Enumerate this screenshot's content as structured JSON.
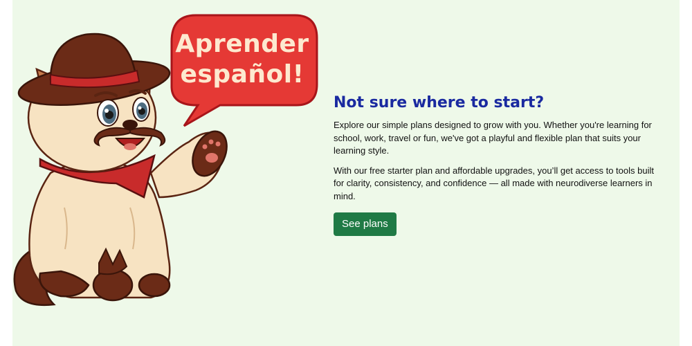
{
  "hero": {
    "speech_bubble_text": "Aprender español!",
    "heading": "Not sure where to start?",
    "paragraph_1": "Explore our simple plans designed to grow with you. Whether you're learning for school, work, travel or fun, we've got a playful and flexible plan that suits your learning style.",
    "paragraph_2": "With our free starter plan and affordable upgrades, you’ll get access to tools built for clarity, consistency, and confidence — all made with neurodiverse learners in mind.",
    "cta_label": "See plans"
  },
  "colors": {
    "panel_background": "#eef9e9",
    "heading": "#1a2aa0",
    "button": "#1f7a45",
    "bubble": "#e53935",
    "bubble_text": "#fde9cf"
  },
  "icons": {
    "mascot": "cat-mascot-illustration",
    "bubble": "speech-bubble-icon"
  }
}
